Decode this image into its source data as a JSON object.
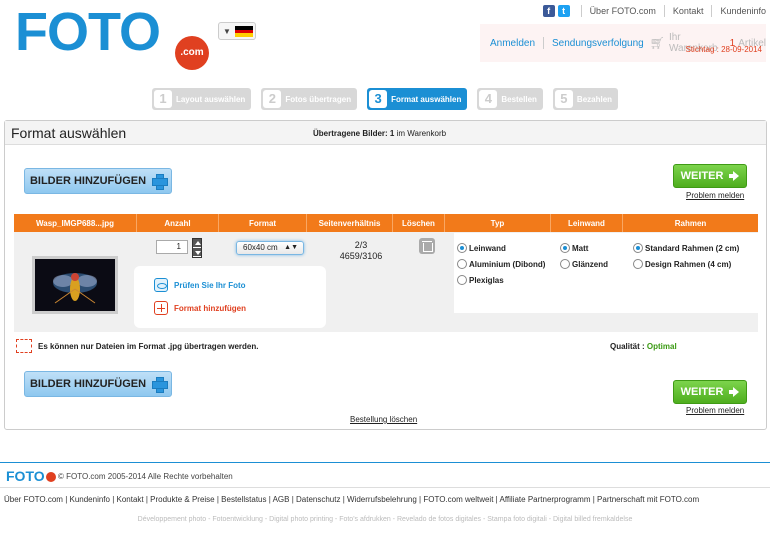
{
  "header": {
    "logo_text": "FOTO",
    "logo_sub": ".com",
    "top_links": [
      "Über FOTO.com",
      "Kontakt",
      "Kundeninfo"
    ],
    "social": [
      {
        "name": "facebook",
        "glyph": "f",
        "color": "#3b5998"
      },
      {
        "name": "twitter",
        "glyph": "t",
        "color": "#1da1f2"
      }
    ],
    "account": {
      "login": "Anmelden",
      "tracking": "Sendungsverfolgung",
      "cart_prefix": "Ihr Warenkorb",
      "cart_count": "1",
      "cart_suffix": "Artikel",
      "stichtag": "Stichtag : 28-09-2014"
    }
  },
  "steps": [
    {
      "num": "1",
      "label": "Layout auswählen",
      "active": false
    },
    {
      "num": "2",
      "label": "Fotos übertragen",
      "active": false
    },
    {
      "num": "3",
      "label": "Format auswählen",
      "active": true
    },
    {
      "num": "4",
      "label": "Bestellen",
      "active": false
    },
    {
      "num": "5",
      "label": "Bezahlen",
      "active": false
    }
  ],
  "panel": {
    "title": "Format auswählen",
    "uploaded_label": "Übertragene Bilder:",
    "uploaded_count": "1",
    "uploaded_suffix": "im Warenkorb",
    "add_images": "BILDER HINZUFÜGEN",
    "next": "WEITER",
    "problem": "Problem melden",
    "delete_order": "Bestellung löschen"
  },
  "table": {
    "columns": [
      "Wasp_IMGP688...jpg",
      "Anzahl",
      "Format",
      "Seitenverhältnis",
      "Löschen",
      "Typ",
      "Leinwand",
      "Rahmen"
    ],
    "quantity": "1",
    "format": "60x40 cm",
    "ratio": "2/3",
    "resolution": "4659/3106",
    "check_photo": "Prüfen Sie Ihr Foto",
    "add_format": "Format hinzufügen",
    "typ_options": [
      {
        "label": "Leinwand",
        "selected": true
      },
      {
        "label": "Aluminium (Dibond)",
        "selected": false
      },
      {
        "label": "Plexiglas",
        "selected": false
      }
    ],
    "leinwand_options": [
      {
        "label": "Matt",
        "selected": true
      },
      {
        "label": "Glänzend",
        "selected": false
      }
    ],
    "rahmen_options": [
      {
        "label": "Standard Rahmen (2 cm)",
        "selected": true
      },
      {
        "label": "Design Rahmen (4 cm)",
        "selected": false
      }
    ],
    "note": "Es können nur Dateien im Format .jpg übertragen werden.",
    "quality_label": "Qualität :",
    "quality_value": "Optimal"
  },
  "footer": {
    "logo": "FOTO",
    "copyright": "© FOTO.com 2005-2014 Alle Rechte vorbehalten",
    "links": "Über FOTO.com | Kundeninfo | Kontakt | Produkte & Preise | Bestellstatus | AGB | Datenschutz | Widerrufsbelehrung | FOTO.com weltweit | Affiliate Partnerprogramm | Partnerschaft mit FOTO.com",
    "languages": "Développement photo - Fotoentwicklung - Digital photo printing - Foto's afdrukken - Revelado de fotos digitales - Stampa foto digitali - Digital billed fremkaldelse"
  },
  "colors": {
    "brand_blue": "#1b8fd4",
    "brand_red": "#e04020",
    "table_orange": "#f27a1a",
    "next_green": "#4fae1e"
  }
}
